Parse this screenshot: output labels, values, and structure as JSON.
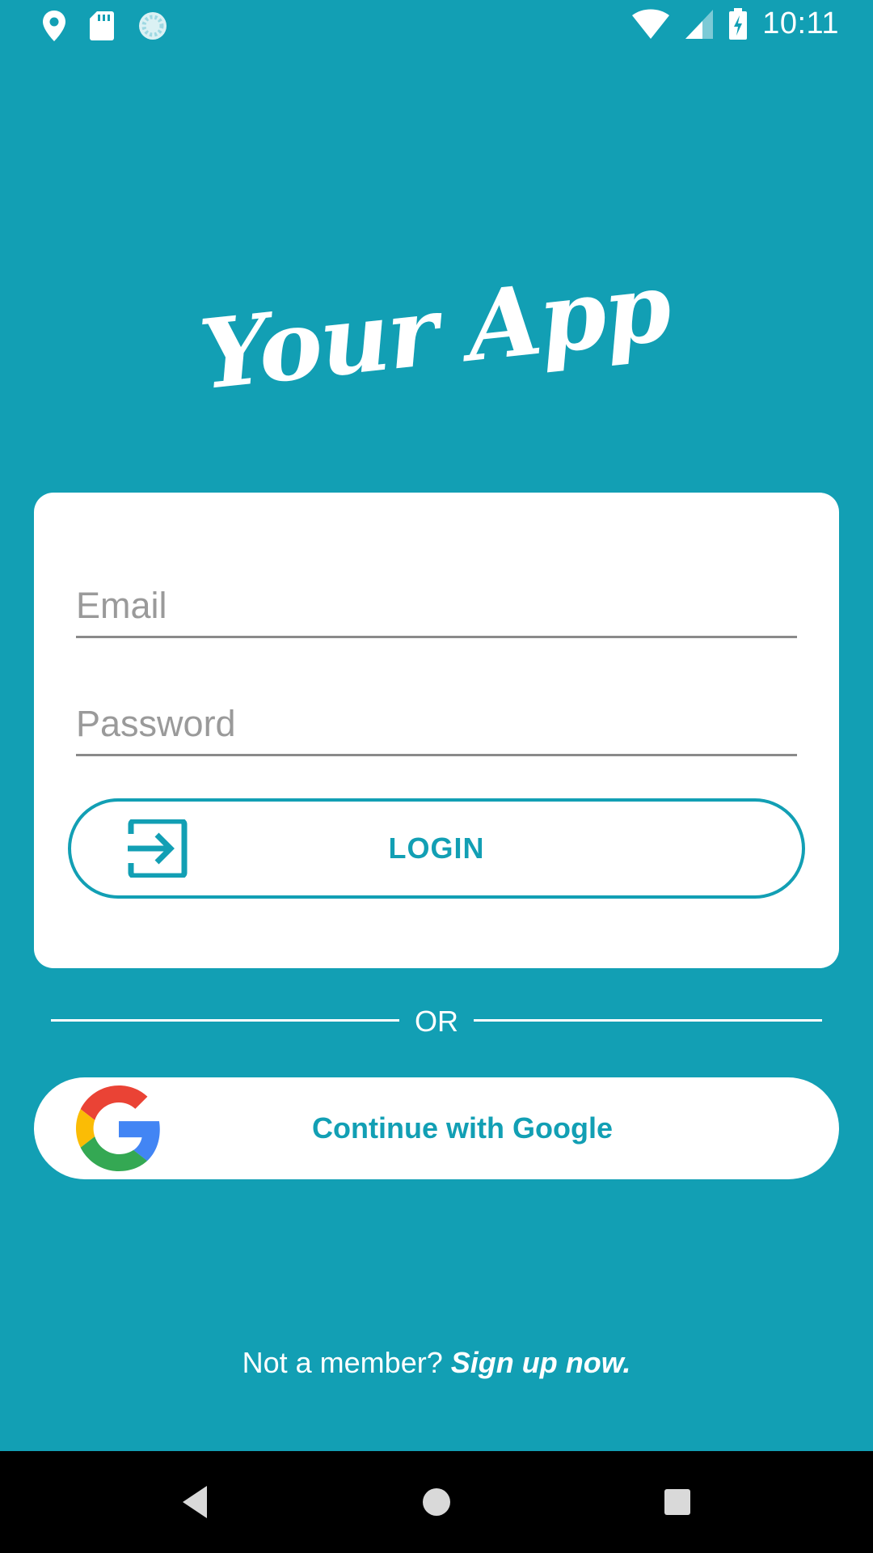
{
  "status_bar": {
    "time": "10:11",
    "icons": [
      "location-icon",
      "sd-card-icon",
      "sync-icon",
      "wifi-icon",
      "cell-signal-icon",
      "battery-charging-icon"
    ]
  },
  "app": {
    "logo_text": "Your App"
  },
  "login_form": {
    "email_placeholder": "Email",
    "password_placeholder": "Password",
    "login_label": "LOGIN",
    "login_icon": "login-arrow-icon"
  },
  "divider": {
    "label": "OR"
  },
  "google": {
    "label": "Continue with Google",
    "icon": "google-logo-icon"
  },
  "signup": {
    "prompt": "Not a member? ",
    "link": "Sign up now."
  },
  "nav_bar": {
    "icons": [
      "back-icon",
      "home-icon",
      "recents-icon"
    ]
  },
  "colors": {
    "background": "#129fb4",
    "accent": "#129fb4",
    "card": "#ffffff",
    "nav_bar": "#000000"
  }
}
